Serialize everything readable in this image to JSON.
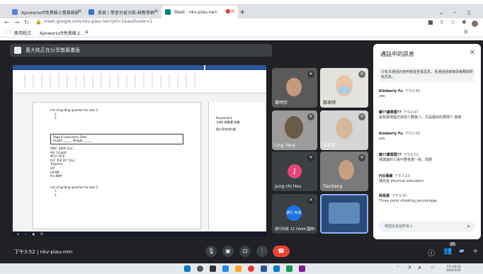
{
  "browser": {
    "tabs": [
      {
        "label": "Apowersoft免費線上螢幕錄影",
        "color": "#5b7fd6"
      },
      {
        "label": "首頁 | 學習台省分區-與教學網",
        "color": "#3b6fd4"
      },
      {
        "label": "Meet - nkv-piau-nen",
        "color": "#00897b"
      }
    ],
    "new_tab": "+",
    "url": "meet.google.com/nkv-piau-nen?pli=1&authuser=1",
    "bookmarks": [
      "應用程式",
      "Apowersoft免費線上…"
    ]
  },
  "meet": {
    "presenting_label": "黃大銘正在分享螢幕畫面",
    "doc_lines": [
      "List of guiding question for task 1:",
      "1.",
      "2.",
      "Page 8 Laboratory Data",
      "Height ______ Weight ______",
      "WBC: 8000 /[uL]",
      "Hb: 14 g/dL",
      "MCV: 90 fl",
      "PLT: 350 10^3/uL",
      "Troponin:",
      "CK:",
      "CK-MB:",
      "Pro-BNP:",
      "List of guiding question for task 2:",
      "1.",
      "2."
    ],
    "side_doc": [
      "Keyword(s):",
      "分組4 細胞膜 結構",
      "請大家完成作業"
    ],
    "tiles": [
      {
        "name": "黃明宇"
      },
      {
        "name": "鄭聿晴"
      },
      {
        "name": "Ling Yang"
      },
      {
        "name": "吳易晉"
      },
      {
        "name": "Jung chi Hsu",
        "initial": "J"
      },
      {
        "name": "Tienliang"
      },
      {
        "name": "德行科技 12 (Valid 國際)",
        "initial": "德行 科技"
      },
      {
        "name": ""
      }
    ],
    "clock": "下午3:52 | nkv-piau-nen",
    "controls": [
      "mic",
      "camera",
      "present",
      "more"
    ],
    "participant_count": "20"
  },
  "chat": {
    "title": "通話中的訊息",
    "notice": "只有本通話的使用者能查看訊息，且通話結束後即會刪除所有訊息。",
    "messages": [
      {
        "who": "Kimberly Fu",
        "time": "下午2:46",
        "text": "yes"
      },
      {
        "who": "賴??黛翠蓉??",
        "time": "下午2:47",
        "text": "是我選擇程式目前人數最少，又是最好的選擇?! 謝謝"
      },
      {
        "who": "Kimberly Fu",
        "time": "下午2:56",
        "text": "yes"
      },
      {
        "who": "賴??黛翠蓉??",
        "time": "下午3:22",
        "text": "我建議的三張中要各選一張，問題"
      },
      {
        "who": "FJU黃總",
        "time": "下午3:23",
        "text": "補充說 physical education"
      },
      {
        "who": "吳易晉",
        "time": "下午3:30",
        "text": "Three point shooting percentage"
      }
    ],
    "input_placeholder": "傳送訊息給所有人"
  },
  "taskbar": {
    "time": "下午 03:52",
    "date": "2022/4/26"
  }
}
